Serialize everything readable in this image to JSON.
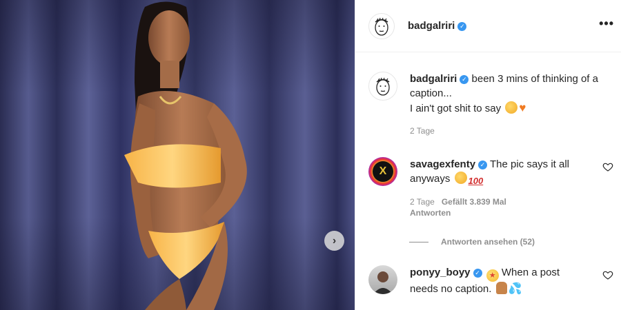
{
  "post": {
    "author": "badgalriri",
    "verified_mark": "✓",
    "more_icon": "more-horizontal-icon"
  },
  "caption": {
    "username": "badgalriri",
    "text_line1": "been 3 mins of thinking of a caption...",
    "text_line2": "I ain't got shit to say",
    "time": "2 Tage"
  },
  "comments": [
    {
      "username": "savagexfenty",
      "text": "The pic says it all anyways",
      "time": "2 Tage",
      "likes": "Gefällt 3.839 Mal",
      "reply": "Antworten",
      "view_replies": "Antworten ansehen (52)"
    },
    {
      "username": "ponyy_boyy",
      "text": "When a post needs no caption.",
      "time": "",
      "likes": "",
      "reply": ""
    }
  ],
  "colors": {
    "verified": "#3897f0",
    "meta": "#8e8e8e",
    "text": "#262626"
  }
}
